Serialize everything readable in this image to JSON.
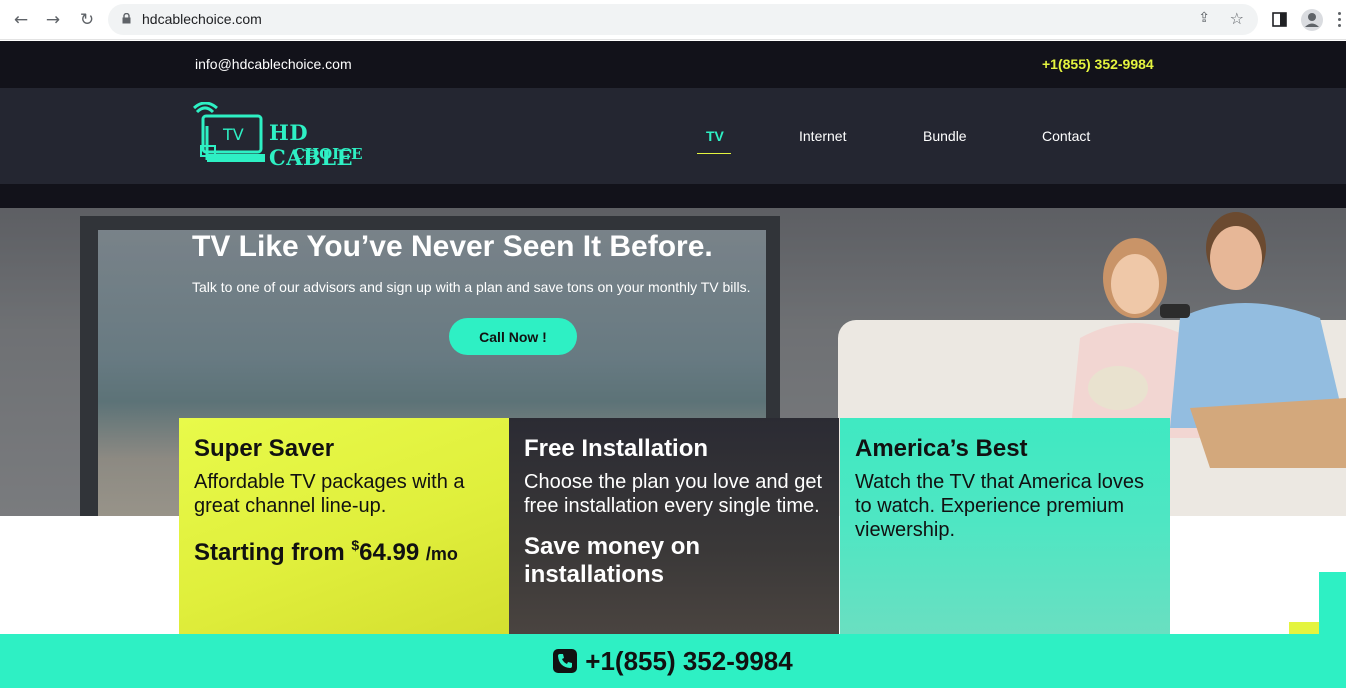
{
  "browser": {
    "url": "hdcablechoice.com"
  },
  "topbar": {
    "email": "info@hdcablechoice.com",
    "phone": "+1(855) 352-9984"
  },
  "header": {
    "logo_line1": "HD CABLE",
    "logo_line2": "CHOICE",
    "logo_tv": "TV",
    "nav": [
      "TV",
      "Internet",
      "Bundle",
      "Contact"
    ],
    "active_nav": "TV"
  },
  "hero": {
    "title": "TV Like You’ve Never Seen It Before.",
    "subtitle": "Talk to one of our advisors and sign up with a plan and save tons on your monthly TV bills.",
    "cta": "Call Now !"
  },
  "cards": [
    {
      "title": "Super Saver",
      "text": "Affordable TV packages with a great channel line-up.",
      "price_prefix": "Starting from",
      "currency": "$",
      "price": "64.99",
      "period": "/mo"
    },
    {
      "title": "Free Installation",
      "text": "Choose the plan you love and get free installation every single time.",
      "extra": "Save money on installations"
    },
    {
      "title": "America’s Best",
      "text": "Watch the TV that America loves to watch. Experience premium viewership."
    }
  ],
  "footer": {
    "phone": "+1(855) 352-9984"
  },
  "colors": {
    "accent_cyan": "#2ef0c4",
    "accent_yellow": "#e4f43f",
    "dark": "#12121a",
    "header": "#242631"
  }
}
